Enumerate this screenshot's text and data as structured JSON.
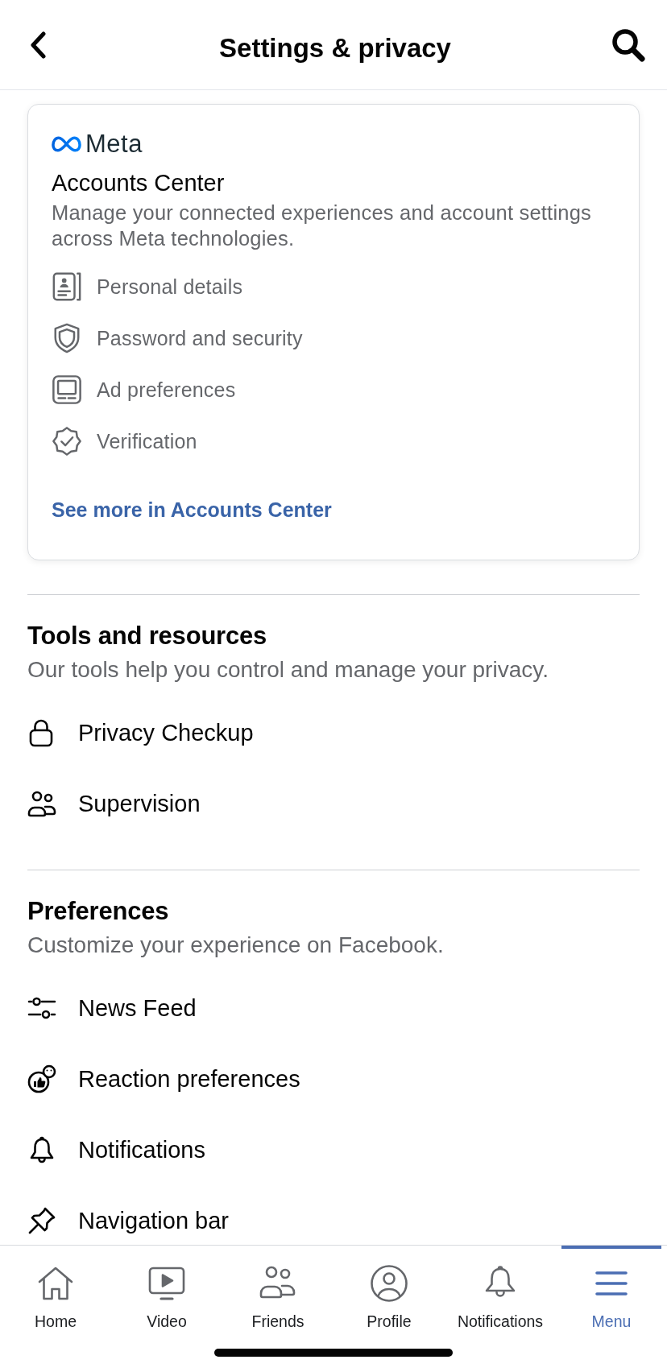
{
  "header": {
    "title": "Settings & privacy"
  },
  "accounts_center": {
    "brand": "Meta",
    "title": "Accounts Center",
    "description": "Manage your connected experiences and account settings across Meta technologies.",
    "items": [
      "Personal details",
      "Password and security",
      "Ad preferences",
      "Verification"
    ],
    "link": "See more in Accounts Center"
  },
  "sections": [
    {
      "title": "Tools and resources",
      "subtitle": "Our tools help you control and manage your privacy.",
      "items": [
        "Privacy Checkup",
        "Supervision"
      ]
    },
    {
      "title": "Preferences",
      "subtitle": "Customize your experience on Facebook.",
      "items": [
        "News Feed",
        "Reaction preferences",
        "Notifications",
        "Navigation bar"
      ]
    }
  ],
  "tab_bar": {
    "tabs": [
      {
        "label": "Home",
        "selected": false
      },
      {
        "label": "Video",
        "selected": false
      },
      {
        "label": "Friends",
        "selected": false
      },
      {
        "label": "Profile",
        "selected": false
      },
      {
        "label": "Notifications",
        "selected": false
      },
      {
        "label": "Menu",
        "selected": true
      }
    ]
  }
}
